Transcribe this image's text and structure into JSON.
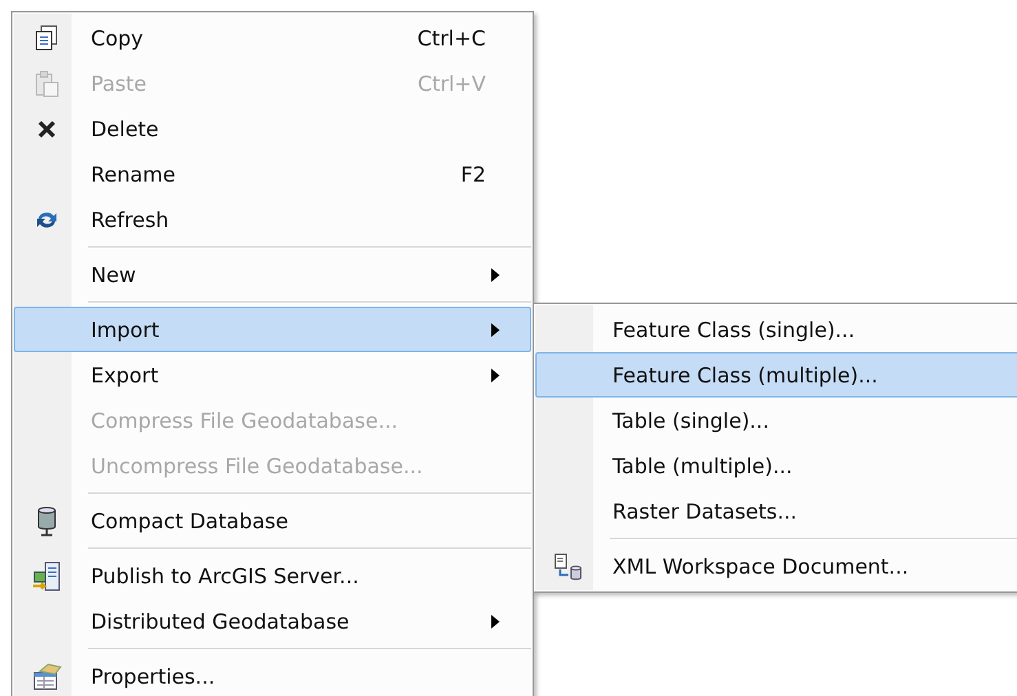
{
  "menu": {
    "items": [
      {
        "kind": "item",
        "label": "Copy",
        "shortcut": "Ctrl+C",
        "disabled": false,
        "selected": false,
        "submenu": false
      },
      {
        "kind": "item",
        "label": "Paste",
        "shortcut": "Ctrl+V",
        "disabled": true,
        "selected": false,
        "submenu": false
      },
      {
        "kind": "item",
        "label": "Delete",
        "disabled": false,
        "selected": false,
        "submenu": false
      },
      {
        "kind": "item",
        "label": "Rename",
        "shortcut": "F2",
        "disabled": false,
        "selected": false,
        "submenu": false
      },
      {
        "kind": "item",
        "label": "Refresh",
        "disabled": false,
        "selected": false,
        "submenu": false
      },
      {
        "kind": "separator"
      },
      {
        "kind": "item",
        "label": "New",
        "disabled": false,
        "selected": false,
        "submenu": true
      },
      {
        "kind": "separator"
      },
      {
        "kind": "item",
        "label": "Import",
        "disabled": false,
        "selected": true,
        "submenu": true
      },
      {
        "kind": "item",
        "label": "Export",
        "disabled": false,
        "selected": false,
        "submenu": true
      },
      {
        "kind": "item",
        "label": "Compress File Geodatabase...",
        "disabled": true,
        "selected": false,
        "submenu": false
      },
      {
        "kind": "item",
        "label": "Uncompress File Geodatabase...",
        "disabled": true,
        "selected": false,
        "submenu": false
      },
      {
        "kind": "separator"
      },
      {
        "kind": "item",
        "label": "Compact Database",
        "disabled": false,
        "selected": false,
        "submenu": false
      },
      {
        "kind": "separator"
      },
      {
        "kind": "item",
        "label": "Publish to ArcGIS Server...",
        "disabled": false,
        "selected": false,
        "submenu": false
      },
      {
        "kind": "item",
        "label": "Distributed Geodatabase",
        "disabled": false,
        "selected": false,
        "submenu": true
      },
      {
        "kind": "separator"
      },
      {
        "kind": "item",
        "label": "Properties...",
        "disabled": false,
        "selected": false,
        "submenu": false
      }
    ]
  },
  "import_submenu": {
    "items": [
      {
        "kind": "item",
        "label": "Feature Class (single)...",
        "selected": false
      },
      {
        "kind": "item",
        "label": "Feature Class (multiple)...",
        "selected": true
      },
      {
        "kind": "item",
        "label": "Table (single)...",
        "selected": false
      },
      {
        "kind": "item",
        "label": "Table (multiple)...",
        "selected": false
      },
      {
        "kind": "item",
        "label": "Raster Datasets...",
        "selected": false
      },
      {
        "kind": "separator"
      },
      {
        "kind": "item",
        "label": "XML Workspace Document...",
        "selected": false
      }
    ]
  }
}
